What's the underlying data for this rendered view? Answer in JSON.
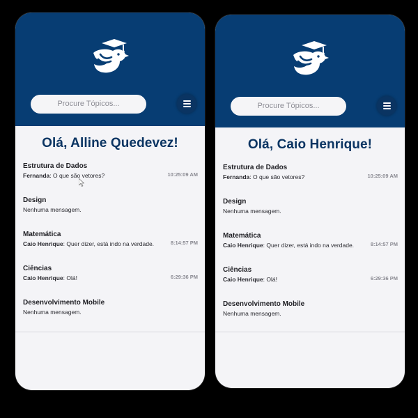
{
  "colors": {
    "header_bg": "#073d73",
    "accent": "#0a3462",
    "body_bg": "#f4f4f7"
  },
  "screens": [
    {
      "logo_icon": "bird-graduation-cap-logo",
      "search_placeholder": "Procure Tópicos...",
      "menu_icon": "hamburger-menu-icon",
      "greeting": "Olá, Alline Quedevez!",
      "topics": [
        {
          "title": "Estrutura de Dados",
          "sender": "Fernanda",
          "message": ": O que são vetores?",
          "time": "10:25:09 AM"
        },
        {
          "title": "Design",
          "sender": "",
          "message": "Nenhuma mensagem.",
          "time": ""
        },
        {
          "title": "Matemática",
          "sender": "Caio Henrique",
          "message": ": Quer dizer, está indo na verdade.",
          "time": "8:14:57 PM"
        },
        {
          "title": "Ciências",
          "sender": "Caio Henrique",
          "message": ": Olá!",
          "time": "6:29:36 PM"
        },
        {
          "title": "Desenvolvimento Mobile",
          "sender": "",
          "message": "Nenhuma mensagem.",
          "time": ""
        }
      ]
    },
    {
      "logo_icon": "bird-graduation-cap-logo",
      "search_placeholder": "Procure Tópicos...",
      "menu_icon": "hamburger-menu-icon",
      "greeting": "Olá, Caio Henrique!",
      "topics": [
        {
          "title": "Estrutura de Dados",
          "sender": "Fernanda",
          "message": ": O que são vetores?",
          "time": "10:25:09 AM"
        },
        {
          "title": "Design",
          "sender": "",
          "message": "Nenhuma mensagem.",
          "time": ""
        },
        {
          "title": "Matemática",
          "sender": "Caio Henrique",
          "message": ": Quer dizer, está indo na verdade.",
          "time": "8:14:57 PM"
        },
        {
          "title": "Ciências",
          "sender": "Caio Henrique",
          "message": ": Olá!",
          "time": "6:29:36 PM"
        },
        {
          "title": "Desenvolvimento Mobile",
          "sender": "",
          "message": "Nenhuma mensagem.",
          "time": ""
        }
      ]
    }
  ]
}
